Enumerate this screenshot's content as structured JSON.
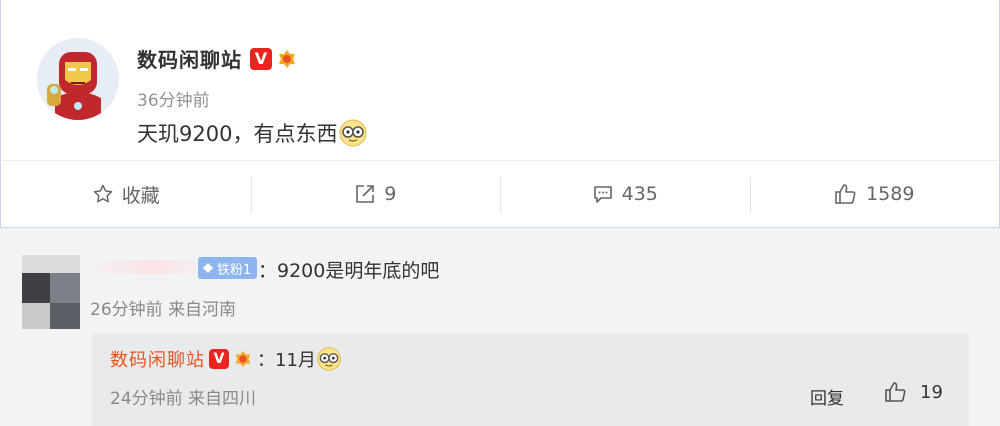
{
  "post": {
    "author": "数码闲聊站",
    "time": "36分钟前",
    "text": "天玑9200，有点东西",
    "emoji_icon": "nerd-glasses-emoji",
    "actions": {
      "favorite_label": "收藏",
      "repost_count": "9",
      "comment_count": "435",
      "like_count": "1589"
    }
  },
  "comment": {
    "fan_badge": "铁粉1",
    "text": "：9200是明年底的吧",
    "meta": "26分钟前 来自河南"
  },
  "reply": {
    "author": "数码闲聊站",
    "text": "：11月",
    "meta": "24分钟前 来自四川",
    "reply_label": "回复",
    "like_count": "19"
  },
  "colors": {
    "verified_red": "#e8251e",
    "reply_author": "#e8531e",
    "fan_badge": "#8fb5f0"
  }
}
